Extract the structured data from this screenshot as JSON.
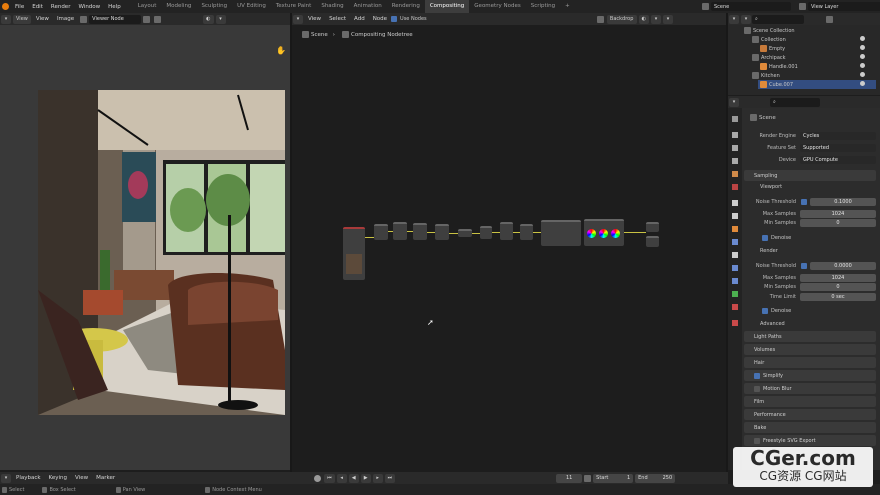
{
  "topbar": {
    "menus": [
      "File",
      "Edit",
      "Render",
      "Window",
      "Help"
    ],
    "workspaces": [
      "Layout",
      "Modeling",
      "Sculpting",
      "UV Editing",
      "Texture Paint",
      "Shading",
      "Animation",
      "Rendering",
      "Compositing",
      "Geometry Nodes",
      "Scripting"
    ],
    "active_workspace": "Compositing",
    "scene": "Scene",
    "view_layer": "View Layer"
  },
  "image_editor": {
    "menus": [
      "View",
      "View",
      "Image"
    ],
    "image_name": "Viewer Node"
  },
  "node_editor": {
    "menus": [
      "View",
      "Select",
      "Add",
      "Node"
    ],
    "use_nodes_label": "Use Nodes",
    "backdrop_label": "Backdrop",
    "breadcrumb_scene": "Scene",
    "breadcrumb_tree": "Compositing Nodetree"
  },
  "outliner": {
    "items": [
      {
        "label": "Scene Collection",
        "indent": 0
      },
      {
        "label": "Collection",
        "indent": 1
      },
      {
        "label": "Empty",
        "indent": 2
      },
      {
        "label": "Archipack",
        "indent": 1
      },
      {
        "label": "Handle.001",
        "indent": 2
      },
      {
        "label": "Kitchen",
        "indent": 1
      },
      {
        "label": "Cube.007",
        "indent": 2
      }
    ]
  },
  "properties": {
    "context": "Scene",
    "render_engine_label": "Render Engine",
    "render_engine": "Cycles",
    "feature_set_label": "Feature Set",
    "feature_set": "Supported",
    "device_label": "Device",
    "device": "GPU Compute",
    "sampling": "Sampling",
    "viewport": "Viewport",
    "noise_threshold_label": "Noise Threshold",
    "viewport_noise": "0.1000",
    "max_samples_label": "Max Samples",
    "viewport_max": "1024",
    "min_samples_label": "Min Samples",
    "viewport_min": "0",
    "denoise": "Denoise",
    "render": "Render",
    "render_noise": "0.0000",
    "render_max": "1024",
    "render_min": "0",
    "time_limit_label": "Time Limit",
    "time_limit": "0 sec",
    "advanced": "Advanced",
    "sections": [
      "Light Paths",
      "Volumes",
      "Hair",
      "Simplify",
      "Motion Blur",
      "Film",
      "Performance",
      "Bake",
      "Freestyle SVG Export"
    ]
  },
  "timeline": {
    "menus": [
      "Playback",
      "Keying",
      "View",
      "Marker"
    ],
    "current_frame": "11",
    "start_label": "Start",
    "start": "1",
    "end_label": "End",
    "end": "250"
  },
  "statusbar": {
    "select": "Select",
    "box_select": "Box Select",
    "pan_view": "Pan View",
    "node_context_menu": "Node Context Menu"
  },
  "watermark": {
    "line1": "CGer.com",
    "line2": "CG资源 CG网站"
  }
}
